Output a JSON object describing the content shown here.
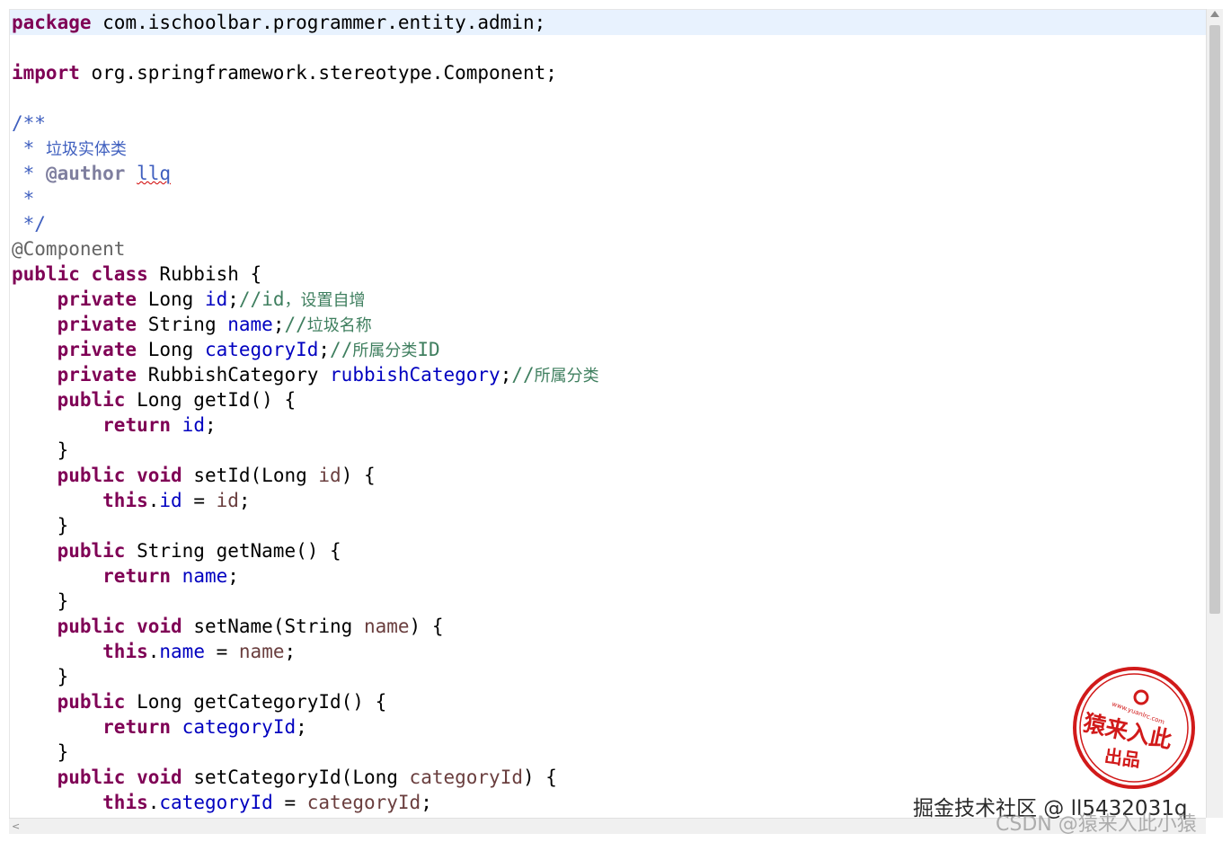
{
  "editor": {
    "lines": [
      [
        {
          "c": "kw",
          "t": "package"
        },
        {
          "c": "",
          "t": " com.ischoolbar.programmer.entity.admin;"
        }
      ],
      [],
      [
        {
          "c": "kw",
          "t": "import"
        },
        {
          "c": "",
          "t": " org.springframework.stereotype.Component;"
        }
      ],
      [],
      [
        {
          "c": "jdoc",
          "t": "/**"
        }
      ],
      [
        {
          "c": "jdoc",
          "t": " * "
        },
        {
          "c": "jdoc cjk",
          "t": "垃圾实体类"
        }
      ],
      [
        {
          "c": "jdoc",
          "t": " * "
        },
        {
          "c": "tag",
          "t": "@author"
        },
        {
          "c": "jdoc",
          "t": " "
        },
        {
          "c": "jdoc squiggle",
          "t": "llq"
        }
      ],
      [
        {
          "c": "jdoc",
          "t": " *"
        }
      ],
      [
        {
          "c": "jdoc",
          "t": " */"
        }
      ],
      [
        {
          "c": "ann",
          "t": "@Component"
        }
      ],
      [
        {
          "c": "kw",
          "t": "public"
        },
        {
          "c": "",
          "t": " "
        },
        {
          "c": "kw",
          "t": "class"
        },
        {
          "c": "",
          "t": " Rubbish {"
        }
      ],
      [
        {
          "c": "",
          "t": "    "
        },
        {
          "c": "kw",
          "t": "private"
        },
        {
          "c": "",
          "t": " Long "
        },
        {
          "c": "field",
          "t": "id"
        },
        {
          "c": "",
          "t": ";"
        },
        {
          "c": "comment",
          "t": "//id"
        },
        {
          "c": "comment cjk",
          "t": "，设置自增"
        }
      ],
      [
        {
          "c": "",
          "t": "    "
        },
        {
          "c": "kw",
          "t": "private"
        },
        {
          "c": "",
          "t": " String "
        },
        {
          "c": "field",
          "t": "name"
        },
        {
          "c": "",
          "t": ";"
        },
        {
          "c": "comment",
          "t": "//"
        },
        {
          "c": "comment cjk",
          "t": "垃圾名称"
        }
      ],
      [
        {
          "c": "",
          "t": "    "
        },
        {
          "c": "kw",
          "t": "private"
        },
        {
          "c": "",
          "t": " Long "
        },
        {
          "c": "field",
          "t": "categoryId"
        },
        {
          "c": "",
          "t": ";"
        },
        {
          "c": "comment",
          "t": "//"
        },
        {
          "c": "comment cjk",
          "t": "所属分类"
        },
        {
          "c": "comment",
          "t": "ID"
        }
      ],
      [
        {
          "c": "",
          "t": "    "
        },
        {
          "c": "kw",
          "t": "private"
        },
        {
          "c": "",
          "t": " RubbishCategory "
        },
        {
          "c": "field",
          "t": "rubbishCategory"
        },
        {
          "c": "",
          "t": ";"
        },
        {
          "c": "comment",
          "t": "//"
        },
        {
          "c": "comment cjk",
          "t": "所属分类"
        }
      ],
      [
        {
          "c": "",
          "t": "    "
        },
        {
          "c": "kw",
          "t": "public"
        },
        {
          "c": "",
          "t": " Long getId() {"
        }
      ],
      [
        {
          "c": "",
          "t": "        "
        },
        {
          "c": "kw",
          "t": "return"
        },
        {
          "c": "",
          "t": " "
        },
        {
          "c": "field",
          "t": "id"
        },
        {
          "c": "",
          "t": ";"
        }
      ],
      [
        {
          "c": "",
          "t": "    }"
        }
      ],
      [
        {
          "c": "",
          "t": "    "
        },
        {
          "c": "kw",
          "t": "public"
        },
        {
          "c": "",
          "t": " "
        },
        {
          "c": "kw",
          "t": "void"
        },
        {
          "c": "",
          "t": " setId(Long "
        },
        {
          "c": "param",
          "t": "id"
        },
        {
          "c": "",
          "t": ") {"
        }
      ],
      [
        {
          "c": "",
          "t": "        "
        },
        {
          "c": "kw",
          "t": "this"
        },
        {
          "c": "",
          "t": "."
        },
        {
          "c": "field",
          "t": "id"
        },
        {
          "c": "",
          "t": " = "
        },
        {
          "c": "param",
          "t": "id"
        },
        {
          "c": "",
          "t": ";"
        }
      ],
      [
        {
          "c": "",
          "t": "    }"
        }
      ],
      [
        {
          "c": "",
          "t": "    "
        },
        {
          "c": "kw",
          "t": "public"
        },
        {
          "c": "",
          "t": " String getName() {"
        }
      ],
      [
        {
          "c": "",
          "t": "        "
        },
        {
          "c": "kw",
          "t": "return"
        },
        {
          "c": "",
          "t": " "
        },
        {
          "c": "field",
          "t": "name"
        },
        {
          "c": "",
          "t": ";"
        }
      ],
      [
        {
          "c": "",
          "t": "    }"
        }
      ],
      [
        {
          "c": "",
          "t": "    "
        },
        {
          "c": "kw",
          "t": "public"
        },
        {
          "c": "",
          "t": " "
        },
        {
          "c": "kw",
          "t": "void"
        },
        {
          "c": "",
          "t": " setName(String "
        },
        {
          "c": "param",
          "t": "name"
        },
        {
          "c": "",
          "t": ") {"
        }
      ],
      [
        {
          "c": "",
          "t": "        "
        },
        {
          "c": "kw",
          "t": "this"
        },
        {
          "c": "",
          "t": "."
        },
        {
          "c": "field",
          "t": "name"
        },
        {
          "c": "",
          "t": " = "
        },
        {
          "c": "param",
          "t": "name"
        },
        {
          "c": "",
          "t": ";"
        }
      ],
      [
        {
          "c": "",
          "t": "    }"
        }
      ],
      [
        {
          "c": "",
          "t": "    "
        },
        {
          "c": "kw",
          "t": "public"
        },
        {
          "c": "",
          "t": " Long getCategoryId() {"
        }
      ],
      [
        {
          "c": "",
          "t": "        "
        },
        {
          "c": "kw",
          "t": "return"
        },
        {
          "c": "",
          "t": " "
        },
        {
          "c": "field",
          "t": "categoryId"
        },
        {
          "c": "",
          "t": ";"
        }
      ],
      [
        {
          "c": "",
          "t": "    }"
        }
      ],
      [
        {
          "c": "",
          "t": "    "
        },
        {
          "c": "kw",
          "t": "public"
        },
        {
          "c": "",
          "t": " "
        },
        {
          "c": "kw",
          "t": "void"
        },
        {
          "c": "",
          "t": " setCategoryId(Long "
        },
        {
          "c": "param",
          "t": "categoryId"
        },
        {
          "c": "",
          "t": ") {"
        }
      ],
      [
        {
          "c": "",
          "t": "        "
        },
        {
          "c": "kw",
          "t": "this"
        },
        {
          "c": "",
          "t": "."
        },
        {
          "c": "field",
          "t": "categoryId"
        },
        {
          "c": "",
          "t": " = "
        },
        {
          "c": "param",
          "t": "categoryId"
        },
        {
          "c": "",
          "t": ";"
        }
      ]
    ]
  },
  "colors": {
    "keyword": "#7f0055",
    "field": "#0000c0",
    "parameter": "#6a3e3e",
    "comment": "#3f7f5f",
    "javadoc": "#3f5fbf",
    "current_line": "#e8f2fe",
    "stamp": "#d11a1a"
  },
  "stamp": {
    "url": "www.yuanlrc.com",
    "main": "猿来入此",
    "sub": "出品"
  },
  "watermark": {
    "line1": "掘金技术社区 @ ll5432031q",
    "line2": "CSDN @猿来入此小猿"
  }
}
